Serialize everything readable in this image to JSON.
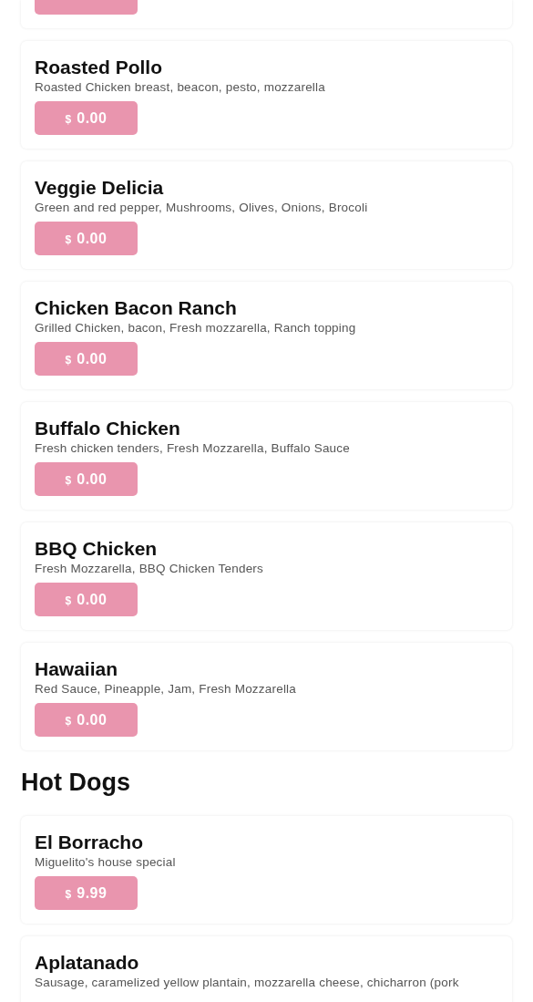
{
  "menu_items": [
    {
      "name": "Roasted Pollo",
      "description": "Roasted Chicken breast, beacon, pesto, mozzarella",
      "currency": "$",
      "price": "0.00"
    },
    {
      "name": "Veggie Delicia",
      "description": "Green and red pepper, Mushrooms, Olives, Onions, Brocoli",
      "currency": "$",
      "price": "0.00"
    },
    {
      "name": "Chicken Bacon Ranch",
      "description": "Grilled Chicken, bacon, Fresh mozzarella, Ranch topping",
      "currency": "$",
      "price": "0.00"
    },
    {
      "name": "Buffalo Chicken",
      "description": "Fresh chicken tenders, Fresh Mozzarella, Buffalo Sauce",
      "currency": "$",
      "price": "0.00"
    },
    {
      "name": "BBQ Chicken",
      "description": "Fresh Mozzarella, BBQ Chicken Tenders",
      "currency": "$",
      "price": "0.00"
    },
    {
      "name": "Hawaiian",
      "description": "Red Sauce, Pineapple, Jam, Fresh Mozzarella",
      "currency": "$",
      "price": "0.00"
    }
  ],
  "hot_dogs": {
    "title": "Hot Dogs",
    "items": [
      {
        "name": "El Borracho",
        "description": "Miguelito's house special",
        "currency": "$",
        "price": "9.99"
      },
      {
        "name": "Aplatanado",
        "description": "Sausage, caramelized yellow plantain, mozzarella cheese, chicharron (pork"
      }
    ]
  }
}
